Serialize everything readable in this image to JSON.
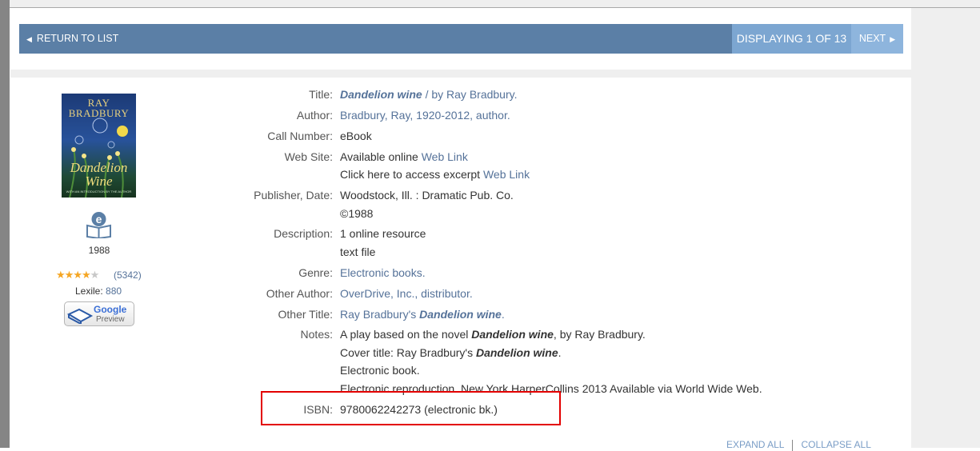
{
  "nav": {
    "return_label": "RETURN TO LIST",
    "display_label": "DISPLAYING 1 OF 13",
    "next_label": "NEXT"
  },
  "cover": {
    "author": "RAY BRADBURY",
    "title": "Dandelion Wine",
    "subtitle": "WITH AN INTRODUCTION BY THE AUTHOR"
  },
  "sidebar": {
    "format_icon": "ebook-icon",
    "year": "1988",
    "rating": 4,
    "rating_max": 5,
    "review_count": "(5342)",
    "lexile_label": "Lexile:",
    "lexile_value": "880",
    "preview_brand": "Google",
    "preview_label": "Preview"
  },
  "record": {
    "title": {
      "label": "Title:",
      "main": "Dandelion wine",
      "rest": " / by Ray Bradbury."
    },
    "author": {
      "label": "Author:",
      "value": "Bradbury, Ray, 1920-2012, author."
    },
    "call_number": {
      "label": "Call Number:",
      "value": "eBook"
    },
    "web_site": {
      "label": "Web Site:",
      "line1_text": "Available online ",
      "line1_link": "Web Link",
      "line2_text": "Click here to access excerpt ",
      "line2_link": "Web Link"
    },
    "publisher": {
      "label": "Publisher, Date:",
      "line1": "Woodstock, Ill. : Dramatic Pub. Co.",
      "line2": "©1988"
    },
    "description": {
      "label": "Description:",
      "line1": "1 online resource",
      "line2": "text file"
    },
    "genre": {
      "label": "Genre:",
      "value": "Electronic books."
    },
    "other_author": {
      "label": "Other Author:",
      "value": "OverDrive, Inc., distributor."
    },
    "other_title": {
      "label": "Other Title:",
      "prefix": "Ray Bradbury's ",
      "title": "Dandelion wine",
      "suffix": "."
    },
    "notes": {
      "label": "Notes:",
      "line1_pre": "A play based on the novel ",
      "line1_em": "Dandelion wine",
      "line1_post": ", by Ray Bradbury.",
      "line2_pre": "Cover title: Ray Bradbury's ",
      "line2_em": "Dandelion wine",
      "line2_post": ".",
      "line3": "Electronic book.",
      "line4": "Electronic reproduction. New York HarperCollins 2013 Available via World Wide Web."
    },
    "isbn": {
      "label": "ISBN:",
      "value": "9780062242273 (electronic bk.)"
    }
  },
  "footer": {
    "expand_label": "EXPAND ALL",
    "collapse_label": "COLLAPSE ALL"
  },
  "colors": {
    "nav_bar": "#5b7fa6",
    "display_box": "#7ca6d1",
    "next_box": "#8eb5dd",
    "link": "#557299",
    "highlight": "#e30000"
  }
}
